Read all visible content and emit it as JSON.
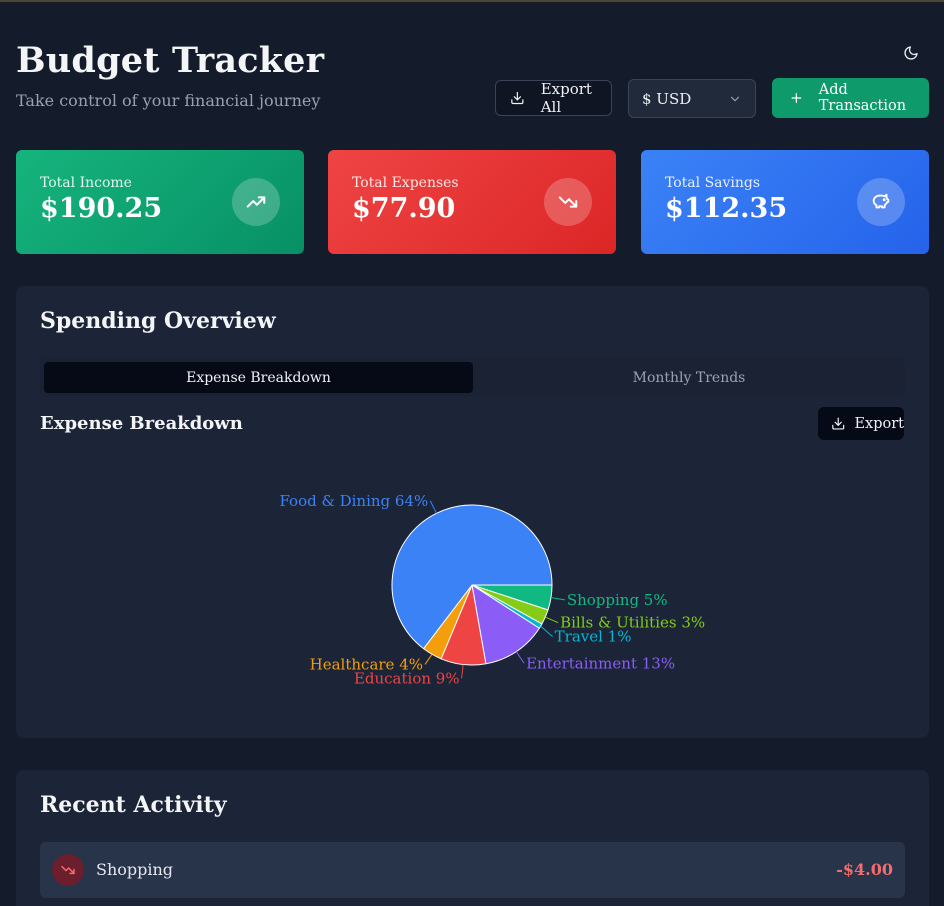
{
  "header": {
    "title": "Budget Tracker",
    "subtitle": "Take control of your financial journey",
    "theme_icon": "moon-icon",
    "export_all_label": "Export All",
    "currency_value": "$ USD",
    "add_transaction_label": "Add Transaction"
  },
  "summary": {
    "income": {
      "label": "Total Income",
      "value": "$190.25",
      "icon": "trending-up-icon",
      "color": "#10b981"
    },
    "expenses": {
      "label": "Total Expenses",
      "value": "$77.90",
      "icon": "trending-down-icon",
      "color": "#ef4444"
    },
    "savings": {
      "label": "Total Savings",
      "value": "$112.35",
      "icon": "piggy-bank-icon",
      "color": "#3b82f6"
    }
  },
  "overview": {
    "title": "Spending Overview",
    "tabs": [
      {
        "label": "Expense Breakdown",
        "active": true
      },
      {
        "label": "Monthly Trends",
        "active": false
      }
    ],
    "section_title": "Expense Breakdown",
    "export_label": "Export"
  },
  "chart_data": {
    "type": "pie",
    "title": "",
    "start_angle_deg": 0,
    "direction": "clockwise-from-3-oclock",
    "slices": [
      {
        "label": "Shopping",
        "percent": 5,
        "color": "#10b981"
      },
      {
        "label": "Bills & Utilities",
        "percent": 3,
        "color": "#84cc16"
      },
      {
        "label": "Travel",
        "percent": 1,
        "color": "#06b6d4"
      },
      {
        "label": "Entertainment",
        "percent": 13,
        "color": "#8b5cf6"
      },
      {
        "label": "Education",
        "percent": 9,
        "color": "#ef4444"
      },
      {
        "label": "Healthcare",
        "percent": 4,
        "color": "#f59e0b"
      },
      {
        "label": "Food & Dining",
        "percent": 64,
        "color": "#3b82f6"
      }
    ]
  },
  "activity": {
    "title": "Recent Activity",
    "items": [
      {
        "label": "Shopping",
        "amount": "-$4.00",
        "icon": "trending-down-icon"
      }
    ]
  }
}
